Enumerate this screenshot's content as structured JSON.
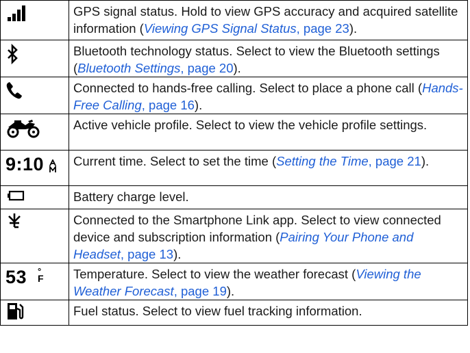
{
  "rows": [
    {
      "icon": "signal-bars-icon",
      "pre": "GPS signal status. Hold to view GPS accuracy and acquired satellite information (",
      "link": "Viewing GPS Signal Status",
      "post_link": ", page 23",
      "tail": ")."
    },
    {
      "icon": "bluetooth-icon",
      "pre": "Bluetooth technology status. Select to view the Bluetooth settings (",
      "link": "Bluetooth Settings",
      "post_link": ", page 20",
      "tail": ")."
    },
    {
      "icon": "phone-icon",
      "pre": "Connected to hands-free calling. Select to place a phone call (",
      "link": "Hands-Free Calling",
      "post_link": ", page 16",
      "tail": ")."
    },
    {
      "icon": "motorcycle-icon",
      "pre": "Active vehicle profile. Select to view the vehicle profile settings."
    },
    {
      "icon": "clock-text",
      "icon_text": "9:10",
      "icon_sub": "A\nM",
      "pre": "Current time. Select to set the time (",
      "link": "Setting the Time",
      "post_link": ", page 21",
      "tail": ")."
    },
    {
      "icon": "battery-icon",
      "pre": "Battery charge level."
    },
    {
      "icon": "smartphone-link-icon",
      "pre": "Connected to the Smartphone Link app. Select to view connected device and subscription information (",
      "link": "Pairing Your Phone and Headset",
      "post_link": ", page 13",
      "tail": ")."
    },
    {
      "icon": "temperature-text",
      "icon_text": "53",
      "icon_deg": "°",
      "icon_unit": "F",
      "pre": "Temperature. Select to view the weather forecast (",
      "link": "Viewing the Weather Forecast",
      "post_link": ", page 19",
      "tail": ")."
    },
    {
      "icon": "fuel-icon",
      "pre": "Fuel status. Select to view fuel tracking information."
    }
  ],
  "colors": {
    "link": "#1f5fd6",
    "text": "#1a1a1a",
    "border": "#000000"
  }
}
